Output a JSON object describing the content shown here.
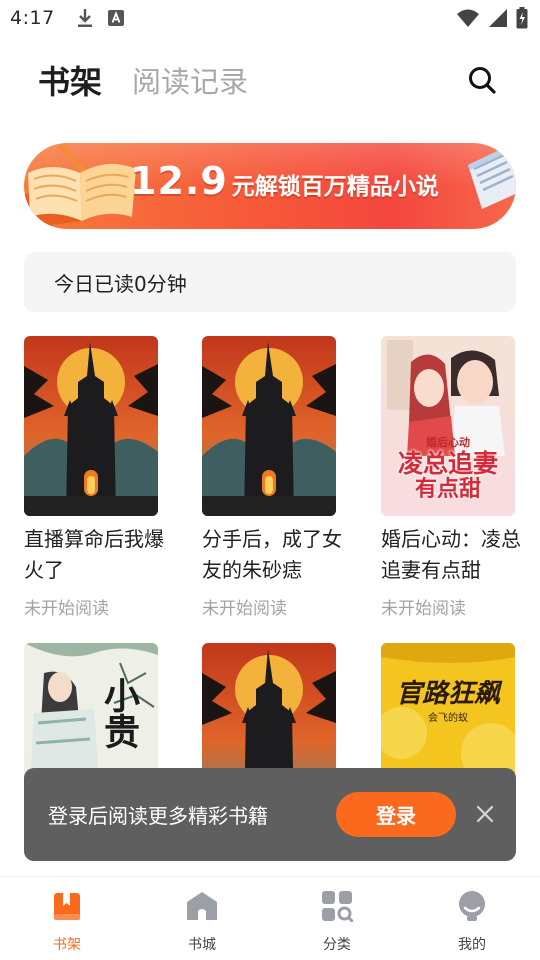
{
  "status_bar": {
    "time": "4:17"
  },
  "header": {
    "tabs": [
      {
        "label": "书架",
        "active": true
      },
      {
        "label": "阅读记录",
        "active": false
      }
    ]
  },
  "banner": {
    "price": "12.9",
    "text": "元解锁百万精品小说"
  },
  "today": {
    "text": "今日已读0分钟"
  },
  "books": [
    {
      "title": "直播算命后我爆火了",
      "status": "未开始阅读",
      "cover": "castle"
    },
    {
      "title": "分手后，成了女友的朱砂痣",
      "status": "未开始阅读",
      "cover": "castle"
    },
    {
      "title": "婚后心动：凌总追妻有点甜",
      "status": "未开始阅读",
      "cover": "romance",
      "cover_title_top": "婚后心动",
      "cover_title_main": "凌总追妻",
      "cover_title_sub": "有点甜"
    },
    {
      "title": "",
      "status": "",
      "cover": "ink",
      "cover_title": "小贵"
    },
    {
      "title": "",
      "status": "",
      "cover": "castle"
    },
    {
      "title": "",
      "status": "",
      "cover": "yellow",
      "cover_title": "官路狂飙",
      "cover_author": "会飞的蚁"
    }
  ],
  "login_prompt": {
    "text": "登录后阅读更多精彩书籍",
    "button": "登录"
  },
  "bottom_nav": [
    {
      "label": "书架",
      "icon": "bookshelf-icon",
      "active": true
    },
    {
      "label": "书城",
      "icon": "bookstore-icon",
      "active": false
    },
    {
      "label": "分类",
      "icon": "category-icon",
      "active": false
    },
    {
      "label": "我的",
      "icon": "profile-icon",
      "active": false
    }
  ],
  "colors": {
    "accent": "#fb6a1c",
    "banner_red": "#f4473e",
    "text_primary": "#222222",
    "text_muted": "#a3a3a3"
  }
}
